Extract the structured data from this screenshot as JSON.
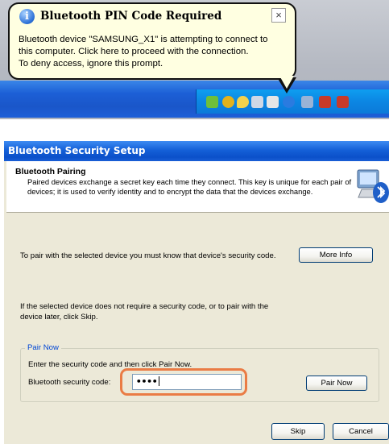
{
  "balloon": {
    "title": "Bluetooth PIN Code Required",
    "close_glyph": "×",
    "info_glyph": "i",
    "body": "Bluetooth device \"SAMSUNG_X1\" is attempting to connect to\nthis computer.  Click here to proceed with the connection.\nTo deny access, ignore this prompt."
  },
  "dialog": {
    "title": "Bluetooth Security Setup",
    "header_title": "Bluetooth Pairing",
    "header_desc": "Paired devices exchange a secret key each time they connect. This key is unique for each pair of devices; it is used to verify identity and to encrypt the data that the devices exchange.",
    "info_text": "To pair with the selected device you must know that device's security code.",
    "more_info_label": "More Info",
    "skip_text": "If the selected device does not require a security code, or to pair with the device later, click Skip.",
    "pair_group": {
      "legend": "Pair Now",
      "instruction": "Enter the security code and then click Pair Now.",
      "code_label": "Bluetooth security code:",
      "code_value": "••••",
      "pair_button_label": "Pair Now"
    },
    "skip_button_label": "Skip",
    "cancel_button_label": "Cancel"
  },
  "colors": {
    "titlebar": "#0b50c9",
    "balloon_bg": "#ffffe1",
    "dialog_bg": "#ece9d8",
    "highlight": "#ea7c45",
    "group_legend": "#0046d5"
  },
  "tray_icons": [
    "network-icon",
    "security-alert-icon",
    "search-icon",
    "display-icon",
    "printer-icon",
    "bluetooth-icon",
    "network-disconnected-icon",
    "network-x-icon",
    "network-x-icon"
  ]
}
